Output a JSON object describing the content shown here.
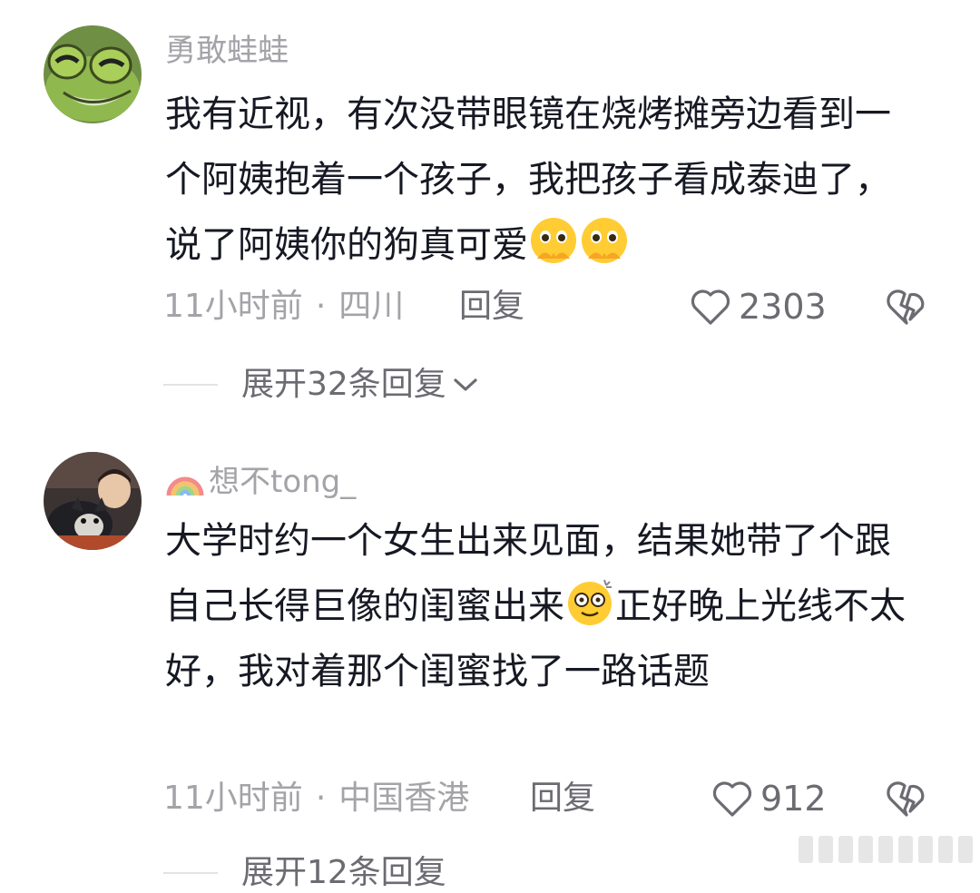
{
  "comments": [
    {
      "username": "勇敢蛙蛙",
      "text": "我有近视，有次没带眼镜在烧烤摊旁边看到一个阿姨抱着一个孩子，我把孩子看成泰迪了，说了阿姨你的狗真可爱",
      "emoji": [
        "pleading-face-hands",
        "pleading-face-hands"
      ],
      "time": "11小时前",
      "location": "四川",
      "reply_label": "回复",
      "likes": "2303",
      "expand_label": "展开32条回复"
    },
    {
      "username": "想不tong_",
      "username_prefix_icon": "rainbow-icon",
      "text_part1": "大学时约一个女生出来见面，结果她带了个跟自己长得巨像的闺蜜出来",
      "emoji": "dizzy-face",
      "text_part2": "正好晚上光线不太好，我对着那个闺蜜找了一路话题",
      "time": "11小时前",
      "location": "中国香港",
      "reply_label": "回复",
      "likes": "912",
      "expand_label": "展开12条回复"
    }
  ],
  "colors": {
    "text": "#161823",
    "meta": "#a3a3a8",
    "secondary": "#6b6b72"
  }
}
